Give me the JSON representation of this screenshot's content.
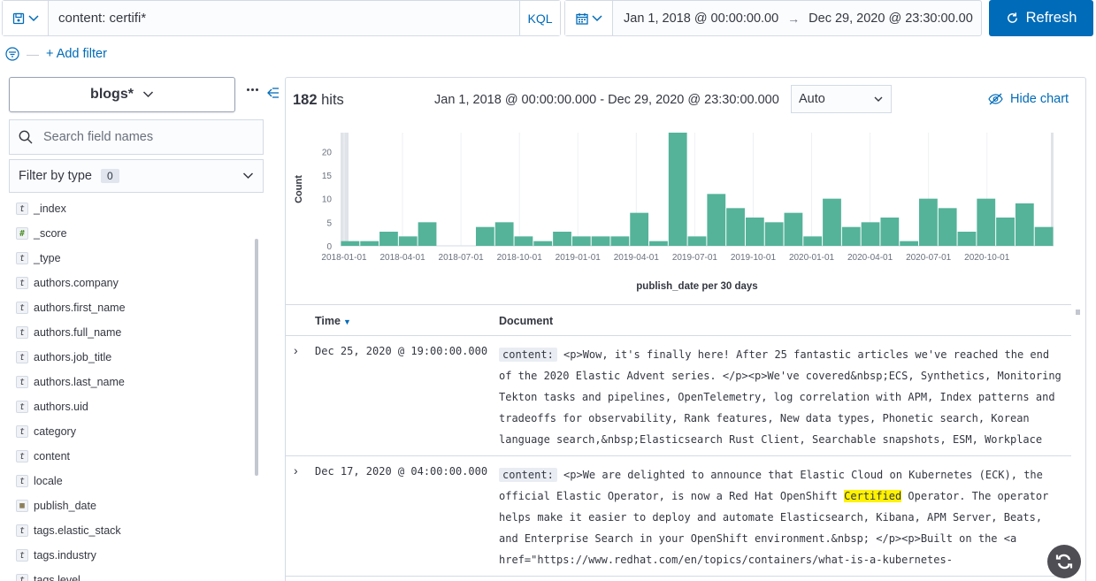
{
  "query": {
    "text": "content: certifi*",
    "language": "KQL"
  },
  "time_range": {
    "start": "Jan 1, 2018 @ 00:00:00.00",
    "end": "Dec 29, 2020 @ 23:30:00.00",
    "arrow": "→"
  },
  "refresh_label": "Refresh",
  "add_filter_label": "+ Add filter",
  "sidebar": {
    "index_pattern": "blogs*",
    "search_placeholder": "Search field names",
    "filter_by_type_label": "Filter by type",
    "filter_count": "0",
    "fields": [
      {
        "type": "t",
        "name": "_index"
      },
      {
        "type": "#",
        "name": "_score"
      },
      {
        "type": "t",
        "name": "_type"
      },
      {
        "type": "t",
        "name": "authors.company"
      },
      {
        "type": "t",
        "name": "authors.first_name"
      },
      {
        "type": "t",
        "name": "authors.full_name"
      },
      {
        "type": "t",
        "name": "authors.job_title"
      },
      {
        "type": "t",
        "name": "authors.last_name"
      },
      {
        "type": "t",
        "name": "authors.uid"
      },
      {
        "type": "t",
        "name": "category"
      },
      {
        "type": "t",
        "name": "content"
      },
      {
        "type": "t",
        "name": "locale"
      },
      {
        "type": "date",
        "name": "publish_date"
      },
      {
        "type": "t",
        "name": "tags.elastic_stack"
      },
      {
        "type": "t",
        "name": "tags.industry"
      },
      {
        "type": "t",
        "name": "tags.level"
      }
    ]
  },
  "results": {
    "hits_count": "182",
    "hits_label": "hits",
    "range_text": "Jan 1, 2018 @ 00:00:00.000 - Dec 29, 2020 @ 23:30:00.000",
    "interval": "Auto",
    "hide_chart_label": "Hide chart"
  },
  "chart_data": {
    "type": "bar",
    "title": "",
    "xlabel": "publish_date per 30 days",
    "ylabel": "Count",
    "ylim": [
      0,
      24
    ],
    "yticks": [
      0,
      5,
      10,
      15,
      20
    ],
    "xticks": [
      "2018-01-01",
      "2018-04-01",
      "2018-07-01",
      "2018-10-01",
      "2019-01-01",
      "2019-04-01",
      "2019-07-01",
      "2019-10-01",
      "2020-01-01",
      "2020-04-01",
      "2020-07-01",
      "2020-10-01"
    ],
    "values": [
      1,
      1,
      3,
      2,
      5,
      0,
      0,
      4,
      5,
      2,
      1,
      3,
      2,
      2,
      2,
      7,
      1,
      24,
      2,
      11,
      8,
      6,
      5,
      7,
      2,
      10,
      4,
      5,
      6,
      1,
      10,
      8,
      3,
      10,
      6,
      9,
      4
    ],
    "color": "#54b399"
  },
  "table": {
    "time_header": "Time",
    "document_header": "Document",
    "rows": [
      {
        "time": "Dec 25, 2020 @ 19:00:00.000",
        "field": "content:",
        "text_before": "<p>Wow, it's finally here! After 25 fantastic articles we've reached the end of the 2020 Elastic Advent series. </p><p>We've covered&nbsp;ECS, Synthetics, Monitoring Tekton tasks and pipelines, OpenTelemetry, log correlation with APM, Index patterns and tradeoffs for observability, Rank features, New data types, Phonetic search, Korean language search,&nbsp;Elasticsearch Rust Client, Searchable snapshots, ESM, Workplace",
        "highlight": "",
        "text_after": ""
      },
      {
        "time": "Dec 17, 2020 @ 04:00:00.000",
        "field": "content:",
        "text_before": "<p>We are delighted to announce that Elastic Cloud on Kubernetes (ECK), the official Elastic Operator, is now a Red Hat OpenShift ",
        "highlight": "Certified",
        "text_after": " Operator. The operator helps make it easier to deploy and automate Elasticsearch, Kibana, APM Server, Beats, and Enterprise Search in your OpenShift environment.&nbsp; </p><p>Built on the <a href=\"https://www.redhat.com/en/topics/containers/what-is-a-kubernetes-"
      }
    ]
  }
}
